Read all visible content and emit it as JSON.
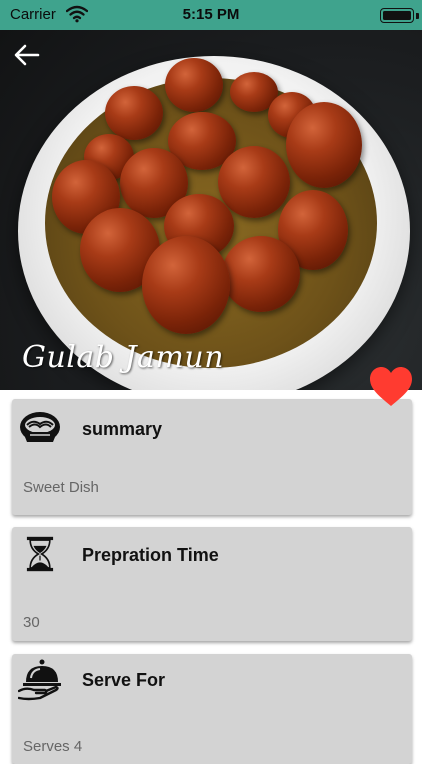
{
  "status_bar": {
    "carrier": "Carrier",
    "time": "5:15 PM",
    "wifi_icon": "wifi-icon",
    "battery_icon": "battery-icon"
  },
  "hero": {
    "title": "Gulab Jamun",
    "back_icon": "arrow-left-icon",
    "favorite_icon": "heart-icon",
    "favorite_color": "#ff3b30"
  },
  "cards": [
    {
      "icon": "bowl-icon",
      "title": "summary",
      "value": "Sweet Dish"
    },
    {
      "icon": "hourglass-icon",
      "title": "Prepration Time",
      "value": "30"
    },
    {
      "icon": "serving-platter-icon",
      "title": "Serve For",
      "value": "Serves 4"
    }
  ],
  "colors": {
    "status_bar": "#3fa38d",
    "card_background": "#d3d3d3",
    "title_text": "#111111",
    "value_text": "#666666"
  }
}
